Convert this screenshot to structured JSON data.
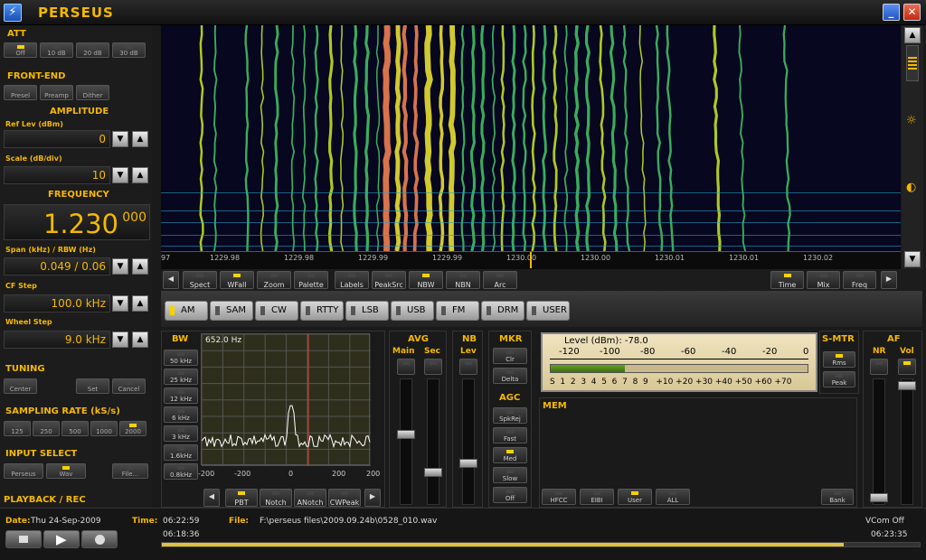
{
  "app": {
    "title": "PERSEUS",
    "icon": "app-logo-icon"
  },
  "window": {
    "minimize": "_",
    "close": "✕",
    "accent": "#f5b800"
  },
  "att": {
    "title": "ATT",
    "buttons": [
      {
        "label": "Off",
        "on": true
      },
      {
        "label": "10 dB",
        "on": false
      },
      {
        "label": "20 dB",
        "on": false
      },
      {
        "label": "30 dB",
        "on": false
      }
    ]
  },
  "frontend": {
    "title": "FRONT-END",
    "buttons": [
      {
        "label": "Presel",
        "on": false
      },
      {
        "label": "Preamp",
        "on": false
      },
      {
        "label": "Dither",
        "on": false
      }
    ]
  },
  "amplitude": {
    "title": "AMPLITUDE",
    "ref_label": "Ref Lev (dBm)",
    "ref_value": "0",
    "scale_label": "Scale (dB/div)",
    "scale_value": "10"
  },
  "frequency": {
    "title": "FREQUENCY",
    "main": "1.230",
    "sub": "000",
    "span_label": "Span (kHz) / RBW (Hz)",
    "span_value": "0.049 / 0.06",
    "cfstep_label": "CF Step",
    "cfstep_value": "100.0 kHz",
    "wheel_label": "Wheel Step",
    "wheel_value": "9.0 kHz"
  },
  "tuning": {
    "title": "TUNING",
    "buttons": [
      "Center",
      "Set",
      "Cancel"
    ]
  },
  "sampling": {
    "title": "SAMPLING RATE (kS/s)",
    "buttons": [
      {
        "label": "125",
        "on": false
      },
      {
        "label": "250",
        "on": false
      },
      {
        "label": "500",
        "on": false
      },
      {
        "label": "1000",
        "on": false
      },
      {
        "label": "2000",
        "on": true
      }
    ]
  },
  "input": {
    "title": "INPUT SELECT",
    "buttons": [
      {
        "label": "Perseus",
        "on": false
      },
      {
        "label": "Wav",
        "on": true
      }
    ],
    "file": "File..."
  },
  "playback": {
    "title": "PLAYBACK / REC"
  },
  "scale": {
    "ticks": [
      "97",
      "1229.98",
      "1229.98",
      "1229.99",
      "1229.99",
      "1230.00",
      "1230.00",
      "1230.01",
      "1230.01",
      "1230.02"
    ]
  },
  "toolbar": {
    "left": [
      {
        "label": "Spect",
        "on": false
      },
      {
        "label": "WFall",
        "on": true
      },
      {
        "label": "Zoom",
        "on": false
      },
      {
        "label": "Palette",
        "on": false
      }
    ],
    "mid": [
      {
        "label": "Labels",
        "on": false
      },
      {
        "label": "PeakSrc",
        "on": false
      },
      {
        "label": "NBW",
        "on": true
      },
      {
        "label": "NBN",
        "on": false
      },
      {
        "label": "Arc",
        "on": false
      }
    ],
    "right": [
      {
        "label": "Time",
        "on": true
      },
      {
        "label": "Mix",
        "on": false
      },
      {
        "label": "Freq",
        "on": false
      }
    ]
  },
  "modes": [
    {
      "label": "AM",
      "on": true
    },
    {
      "label": "SAM",
      "on": false
    },
    {
      "label": "CW",
      "on": false
    },
    {
      "label": "RTTY",
      "on": false
    },
    {
      "label": "LSB",
      "on": false
    },
    {
      "label": "USB",
      "on": false
    },
    {
      "label": "FM",
      "on": false
    },
    {
      "label": "DRM",
      "on": false
    },
    {
      "label": "USER",
      "on": false
    }
  ],
  "bw": {
    "title": "BW",
    "value": "652.0 Hz",
    "buttons": [
      "50 kHz",
      "25 kHz",
      "12 kHz",
      "6 kHz",
      "3 kHz",
      "1.6kHz",
      "0.8kHz"
    ],
    "xticks": [
      "-200",
      "-200",
      "0",
      "200",
      "200"
    ],
    "bottom": [
      {
        "label": "PBT",
        "on": true
      },
      {
        "label": "Notch",
        "on": false
      },
      {
        "label": "ANotch",
        "on": false
      },
      {
        "label": "CWPeak",
        "on": false
      }
    ]
  },
  "avg": {
    "title": "AVG",
    "main": "Main",
    "sec": "Sec"
  },
  "nb": {
    "title": "NB",
    "lev": "Lev"
  },
  "mkr": {
    "title": "MKR",
    "buttons": [
      "Clr",
      "Delta"
    ]
  },
  "agc": {
    "title": "AGC",
    "buttons": [
      {
        "label": "SpkRej",
        "on": false
      },
      {
        "label": "Fast",
        "on": false
      },
      {
        "label": "Med",
        "on": true
      },
      {
        "label": "Slow",
        "on": false
      },
      {
        "label": "Off",
        "on": false
      }
    ]
  },
  "smeter": {
    "level_label": "Level (dBm): -78.0",
    "dbm_scale": [
      "-120",
      "-100",
      "-80",
      "-60",
      "-40",
      "-20",
      "0"
    ],
    "s_scale": "S  1  2  3  4  5  6  7  8  9   +10 +20 +30 +40 +50 +60 +70",
    "level_fraction": 0.29
  },
  "smtr": {
    "title": "S-MTR",
    "buttons": [
      {
        "label": "Rms",
        "on": true
      },
      {
        "label": "Peak",
        "on": false
      }
    ]
  },
  "af": {
    "title": "AF",
    "nr": "NR",
    "vol": "Vol"
  },
  "mem": {
    "title": "MEM",
    "buttons": [
      {
        "label": "HFCC",
        "on": false
      },
      {
        "label": "EIBI",
        "on": false
      },
      {
        "label": "User",
        "on": true
      },
      {
        "label": "ALL",
        "on": false
      }
    ],
    "bank": "Bank"
  },
  "status": {
    "date_label": "Date:",
    "date": "Thu 24-Sep-2009",
    "time_label": "Time:",
    "time": "06:22:59",
    "file_label": "File:",
    "file": "F:\\perseus files\\2009.09.24b\\0528_010.wav",
    "vcom": "VCom Off",
    "start": "06:18:36",
    "end": "06:23:35",
    "progress": 0.9
  }
}
